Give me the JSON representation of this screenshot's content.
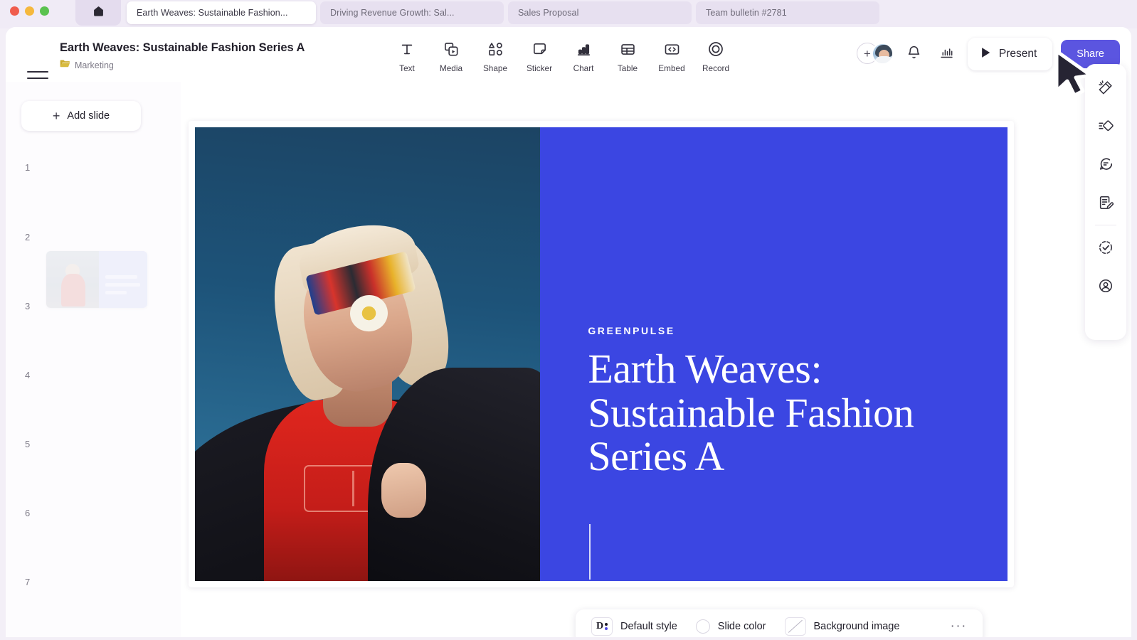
{
  "browser": {
    "home_tab_icon": "home-icon",
    "tabs": [
      {
        "label": "Earth Weaves: Sustainable Fashion...",
        "active": true
      },
      {
        "label": "Driving Revenue Growth: Sal...",
        "active": false
      },
      {
        "label": "Sales Proposal",
        "active": false
      },
      {
        "label": "Team bulletin #2781",
        "active": false
      }
    ]
  },
  "header": {
    "menu_icon": "hamburger-icon",
    "title": "Earth Weaves: Sustainable Fashion Series A",
    "folder_icon": "folder-icon",
    "folder_label": "Marketing",
    "tools": [
      {
        "label": "Text",
        "icon": "text-icon"
      },
      {
        "label": "Media",
        "icon": "media-icon"
      },
      {
        "label": "Shape",
        "icon": "shape-icon"
      },
      {
        "label": "Sticker",
        "icon": "sticker-icon"
      },
      {
        "label": "Chart",
        "icon": "chart-icon"
      },
      {
        "label": "Table",
        "icon": "table-icon"
      },
      {
        "label": "Embed",
        "icon": "embed-icon"
      },
      {
        "label": "Record",
        "icon": "record-icon"
      }
    ],
    "invite_plus": "+",
    "avatar_name": "user-avatar",
    "bell_icon": "bell-icon",
    "analytics_icon": "analytics-icon",
    "present_label": "Present",
    "share_label": "Share",
    "share_color": "#5b55e0"
  },
  "left_panel": {
    "add_slide_label": "Add slide",
    "add_slide_plus": "+",
    "slide_numbers": [
      "1",
      "2",
      "3",
      "4",
      "5",
      "6",
      "7"
    ]
  },
  "slide": {
    "kicker": "GREENPULSE",
    "title": "Earth Weaves: Sustainable Fashion Series A",
    "background_color": "#3b46e2",
    "text_color": "#ffffff",
    "photo_alt": "woman-in-sunglasses-photo"
  },
  "style_bar": {
    "style_chip_letter": "D",
    "style_label": "Default style",
    "slide_color_label": "Slide color",
    "background_image_label": "Background image",
    "more_label": "···"
  },
  "right_rail": {
    "items": [
      {
        "icon": "magic-wand-icon"
      },
      {
        "icon": "animation-icon"
      },
      {
        "icon": "comment-icon"
      },
      {
        "icon": "notes-icon"
      },
      {
        "icon": "tasks-icon"
      },
      {
        "icon": "person-icon"
      }
    ]
  },
  "cursor": {
    "name": "mouse-pointer"
  }
}
